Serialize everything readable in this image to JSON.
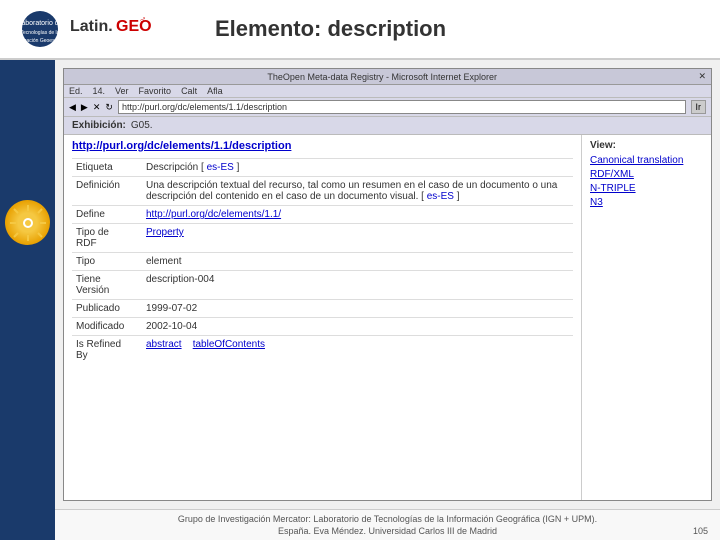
{
  "header": {
    "logo_latin": "Latin.",
    "logo_geo": "GEO",
    "subtitle": "Laboratorio de Tecnologías de la Información Geoespacial",
    "page_title": "Elemento:",
    "page_title_element": "description"
  },
  "browser": {
    "titlebar": "TheOpen Meta-data Registry - Microsoft Internet Explorer",
    "menubar": [
      "Ed.",
      "14.",
      "Ver",
      "Favorito",
      "Calt",
      "Afla"
    ],
    "address_bar": "http://purl.org/dc/elements/1.1/description",
    "exhibition_label": "Exhibición:",
    "exhibition_value": "G05."
  },
  "content": {
    "url": "http://purl.org/dc/elements/1.1/description",
    "rows": [
      {
        "label": "Etiqueta",
        "value": "Descripción [ es-ES ]"
      },
      {
        "label": "Definición",
        "value": "Una descripción textual del recurso, tal como un resumen en el caso de un documento o una descripción del contenido en el caso de un documento visual. [ es-ES ]"
      },
      {
        "label": "Define",
        "value": "http://purl.org/dc/elements/1.1/"
      },
      {
        "label": "Tipo de RDF",
        "value": "Property"
      },
      {
        "label": "Tipo",
        "value": "element"
      },
      {
        "label": "Tiene Versión",
        "value": "description-004"
      },
      {
        "label": "Publicado",
        "value": "1999-07-02"
      },
      {
        "label": "Modificado",
        "value": "2002-10-04"
      },
      {
        "label": "Is Refined By",
        "value": "abstract   tableOfContents"
      }
    ]
  },
  "sidebar_right": {
    "header": "View:",
    "links": [
      "Canonical translation",
      "RDF/XML",
      "N-TRIPLE",
      "N3"
    ]
  },
  "footer": {
    "line1": "Grupo de Investigación Mercator: Laboratorio de Tecnologías de la Información Geográfica (IGN + UPM).",
    "line2": "España. Eva Méndez. Universidad Carlos III de Madrid",
    "page": "105"
  }
}
